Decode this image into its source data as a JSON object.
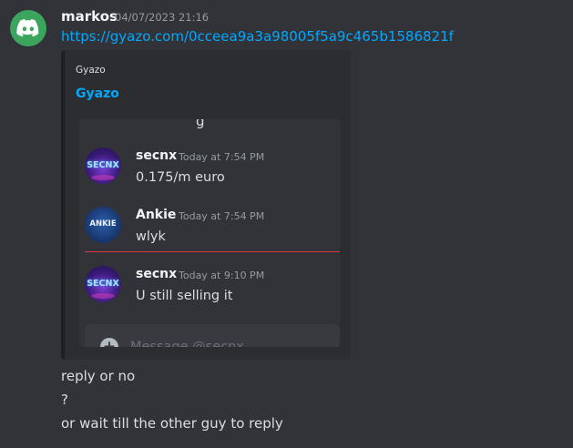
{
  "message": {
    "username": "markos",
    "timestamp": "04/07/2023 21:16",
    "link": "https://gyazo.com/0cceea9a3a98005f5a9c465b1586821f",
    "embed": {
      "provider": "Gyazo",
      "title": "Gyazo",
      "screenshot": {
        "cut_text": "g",
        "messages": [
          {
            "name": "secnx",
            "time": "Today at 7:54 PM",
            "text": "0.175/m euro",
            "avatar_text": "SECNX"
          },
          {
            "name": "Ankie",
            "time": "Today at 7:54 PM",
            "text": "wlyk",
            "avatar_text": "ANKIE"
          },
          {
            "name": "secnx",
            "time": "Today at 9:10 PM",
            "text": "U still selling it",
            "avatar_text": "SECNX"
          }
        ],
        "composer_placeholder": "Message @secnx",
        "new_messages_divider_color": "#d83c3e"
      }
    },
    "followups": [
      "reply or no",
      "?",
      "or wait till the other guy to reply"
    ]
  },
  "colors": {
    "background": "#323339",
    "link": "#00a8fc",
    "avatar_bg": "#3ba55d",
    "embed_bg": "#2b2d31"
  },
  "icons": {
    "main_avatar": "discord-logo-icon",
    "composer_add": "plus-circle-icon"
  }
}
